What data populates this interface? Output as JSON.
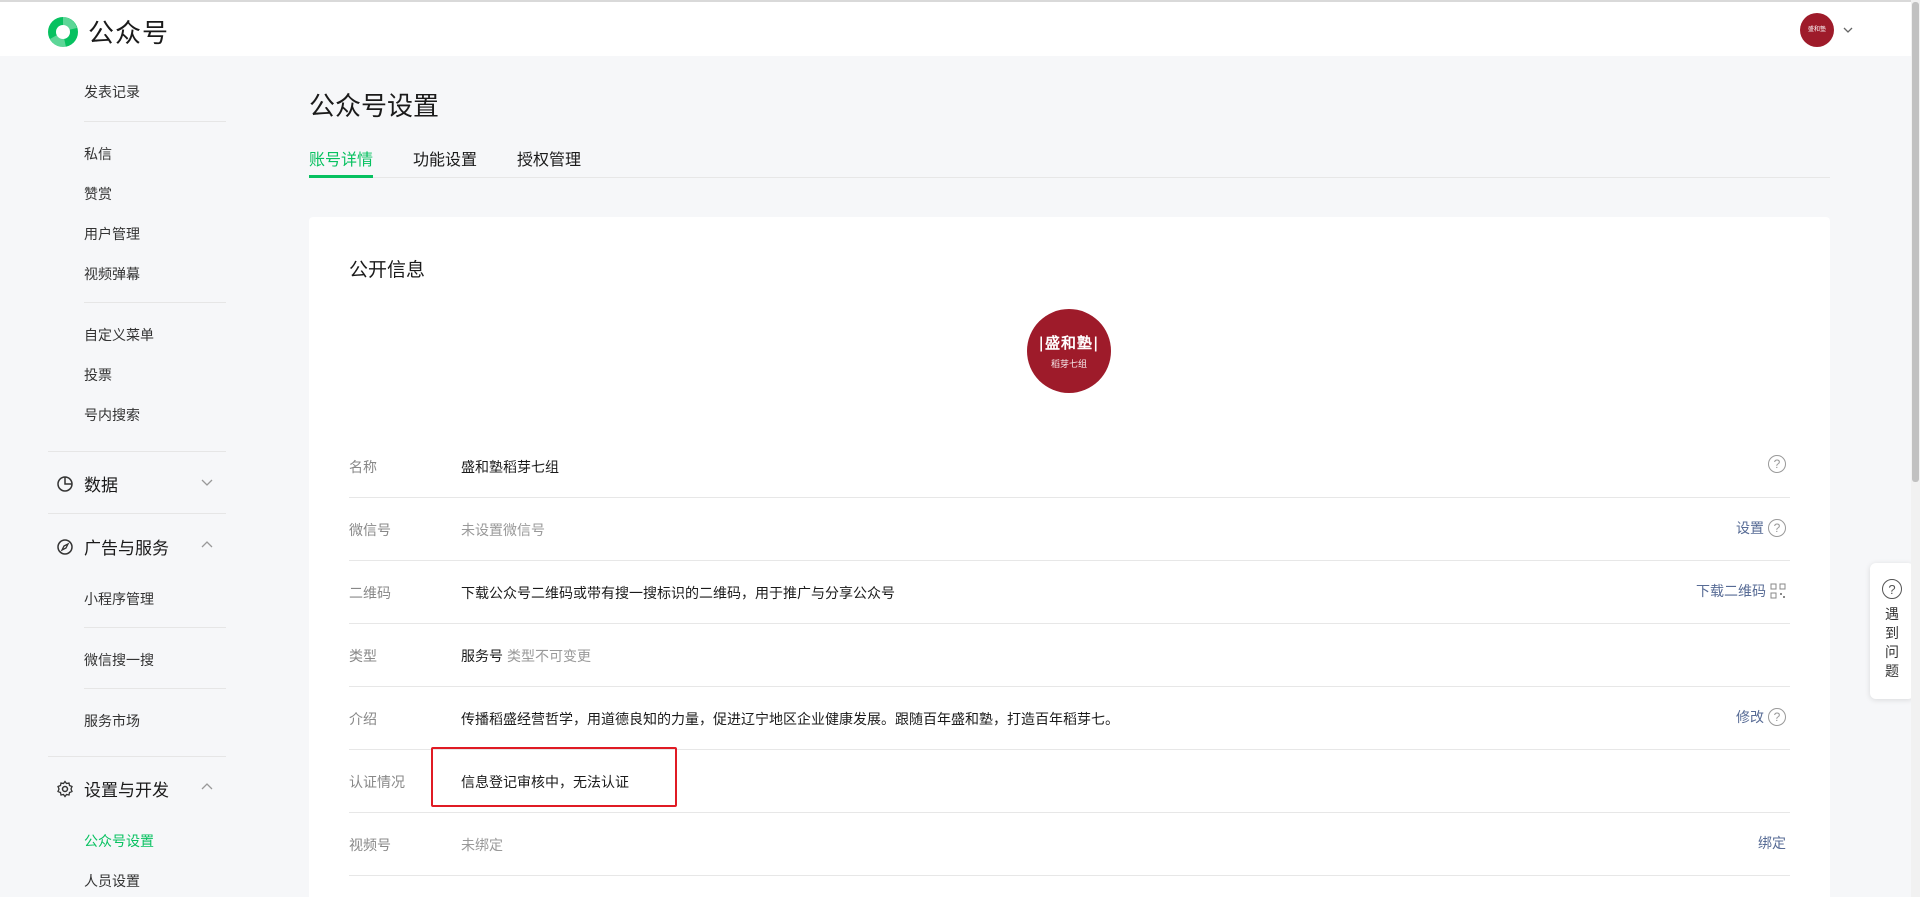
{
  "header": {
    "app_name": "公众号",
    "user_avatar_text": "盛和塾",
    "accent_color": "#07c160"
  },
  "sidebar": {
    "items_top": [
      {
        "label": "发表记录"
      },
      {
        "label": "私信"
      },
      {
        "label": "赞赏"
      },
      {
        "label": "用户管理"
      },
      {
        "label": "视频弹幕"
      },
      {
        "label": "自定义菜单"
      },
      {
        "label": "投票"
      },
      {
        "label": "号内搜索"
      }
    ],
    "groups": [
      {
        "label": "数据",
        "icon": "pie-chart-icon",
        "expanded": false
      },
      {
        "label": "广告与服务",
        "icon": "compass-icon",
        "expanded": true
      },
      {
        "label": "设置与开发",
        "icon": "gear-icon",
        "expanded": true
      }
    ],
    "ads_items": [
      {
        "label": "小程序管理"
      },
      {
        "label": "微信搜一搜"
      },
      {
        "label": "服务市场"
      }
    ],
    "settings_items": [
      {
        "label": "公众号设置",
        "active": true
      },
      {
        "label": "人员设置"
      }
    ]
  },
  "main": {
    "page_title": "公众号设置",
    "tabs": [
      {
        "label": "账号详情",
        "active": true
      },
      {
        "label": "功能设置"
      },
      {
        "label": "授权管理"
      }
    ],
    "section_title": "公开信息",
    "avatar": {
      "main": "|盛和塾|",
      "sub": "稻芽七组"
    },
    "rows": [
      {
        "label": "名称",
        "value": "盛和塾稻芽七组"
      },
      {
        "label": "微信号",
        "value": "未设置微信号",
        "action": "设置"
      },
      {
        "label": "二维码",
        "value": "下载公众号二维码或带有搜一搜标识的二维码，用于推广与分享公众号",
        "action": "下载二维码"
      },
      {
        "label": "类型",
        "value": "服务号",
        "value_note": "类型不可变更"
      },
      {
        "label": "介绍",
        "value": "传播稻盛经营哲学，用道德良知的力量，促进辽宁地区企业健康发展。跟随百年盛和塾，打造百年稻芽七。",
        "action": "修改"
      },
      {
        "label": "认证情况",
        "value": "信息登记审核中，无法认证"
      },
      {
        "label": "视频号",
        "value": "未绑定",
        "action": "绑定"
      }
    ]
  },
  "help_float": {
    "label": "遇到问题"
  }
}
